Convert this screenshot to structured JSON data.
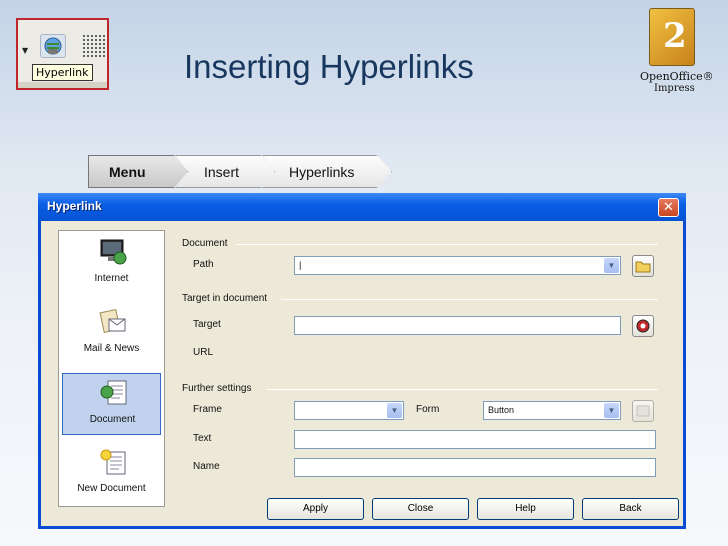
{
  "slide": {
    "title": "Inserting Hyperlinks"
  },
  "inset": {
    "tooltip": "Hyperlink"
  },
  "logo": {
    "line1": "OpenOffice®",
    "line2": "Impress"
  },
  "breadcrumb": {
    "menu": "Menu",
    "insert": "Insert",
    "hyperlinks": "Hyperlinks"
  },
  "dialog": {
    "title": "Hyperlink",
    "types": [
      {
        "label": "Internet"
      },
      {
        "label": "Mail & News"
      },
      {
        "label": "Document",
        "selected": true
      },
      {
        "label": "New Document"
      }
    ],
    "document": {
      "section": "Document",
      "path_label": "Path",
      "path_value": "|"
    },
    "target": {
      "section": "Target in document",
      "target_label": "Target",
      "url_label": "URL"
    },
    "further": {
      "section": "Further settings",
      "frame_label": "Frame",
      "form_label": "Form",
      "form_value": "Button",
      "text_label": "Text",
      "name_label": "Name"
    },
    "buttons": {
      "apply": "Apply",
      "close": "Close",
      "help": "Help",
      "back": "Back"
    }
  },
  "colors": {
    "title": "#17375e",
    "titlebar": "#0a5ee6",
    "selected": "#c1d2ee"
  }
}
